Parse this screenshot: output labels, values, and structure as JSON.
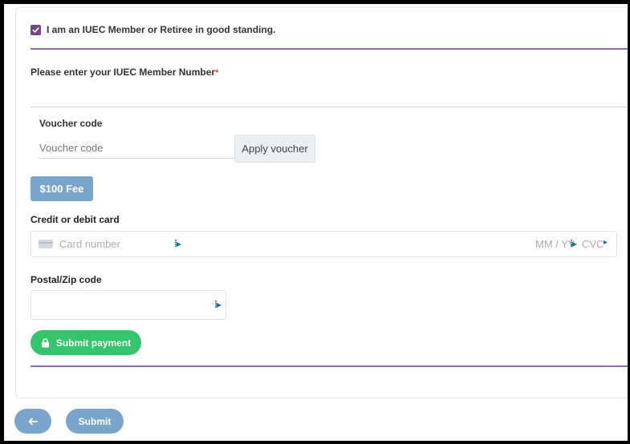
{
  "membership": {
    "checked": true,
    "label": "I am an IUEC Member or Retiree in good standing."
  },
  "member_number": {
    "label": "Please enter your IUEC Member Number",
    "required_mark": "*"
  },
  "voucher": {
    "label": "Voucher code",
    "placeholder": "Voucher code",
    "apply_label": "Apply voucher"
  },
  "fee": {
    "label": "$100 Fee"
  },
  "card": {
    "label": "Credit or debit card",
    "number_placeholder": "Card number",
    "expiry_placeholder": "MM / YY",
    "cvc_placeholder": "CVC",
    "autofill_icon": "password-manager-icon"
  },
  "postal": {
    "label": "Postal/Zip code"
  },
  "submit_payment": {
    "label": "Submit payment",
    "icon": "lock-icon"
  },
  "footer": {
    "back_icon": "arrow-left-icon",
    "submit_label": "Submit"
  },
  "colors": {
    "accent_purple": "#8a6bb0",
    "checkbox": "#6e4a7e",
    "button_blue": "#79a5cb",
    "success_green": "#34c46b"
  }
}
